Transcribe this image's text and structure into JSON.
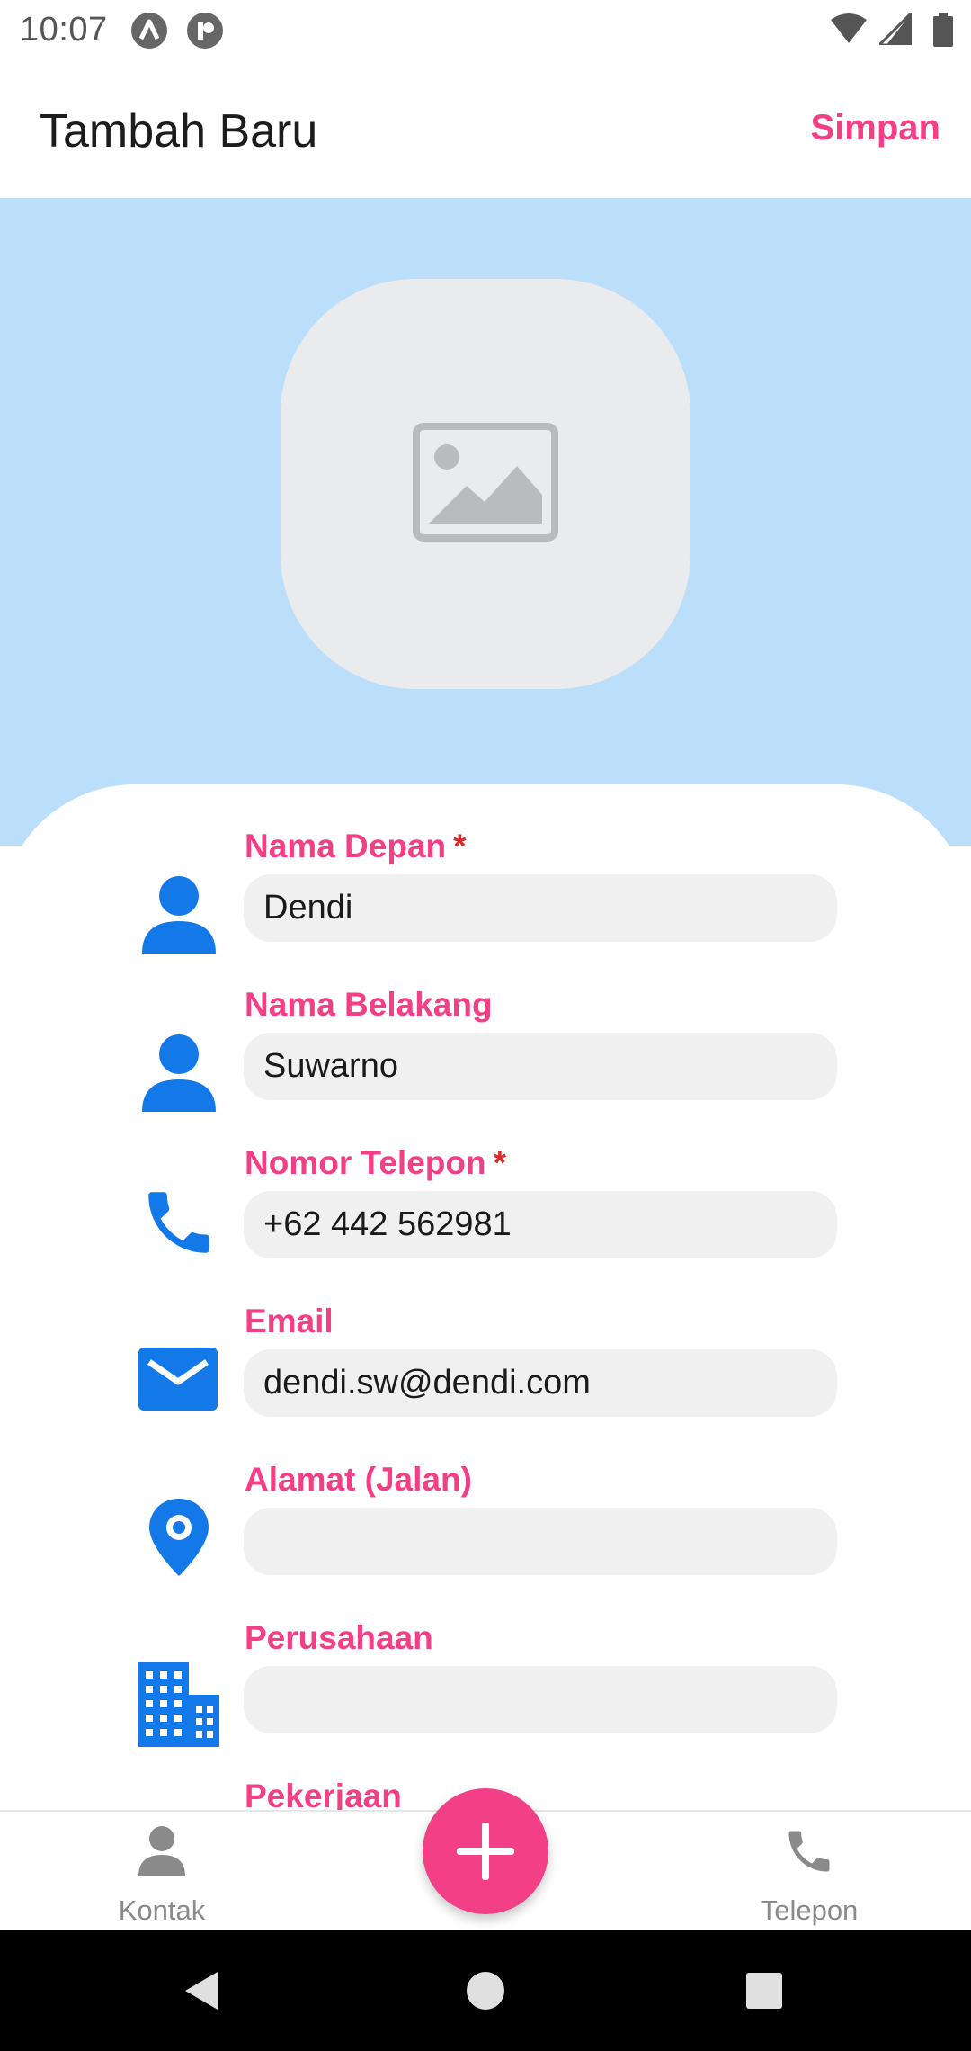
{
  "status_bar": {
    "time": "10:07",
    "left_icons": [
      "app-a-icon",
      "app-p-icon"
    ],
    "right_icons": [
      "wifi-icon",
      "cellular-signal-icon",
      "battery-icon"
    ]
  },
  "app_bar": {
    "title": "Tambah Baru",
    "save_label": "Simpan"
  },
  "photo": {
    "icon": "image-placeholder-icon"
  },
  "fields": [
    {
      "label": "Nama Depan",
      "required_mark": "*",
      "value": "Dendi",
      "icon": "person-icon"
    },
    {
      "label": "Nama Belakang",
      "required_mark": "",
      "value": "Suwarno",
      "icon": "person-icon"
    },
    {
      "label": "Nomor Telepon",
      "required_mark": "*",
      "value": "+62 442 562981",
      "icon": "phone-icon"
    },
    {
      "label": "Email",
      "required_mark": "",
      "value": "dendi.sw@dendi.com",
      "icon": "email-icon"
    },
    {
      "label": "Alamat (Jalan)",
      "required_mark": "",
      "value": "",
      "icon": "location-pin-icon"
    },
    {
      "label": "Perusahaan",
      "required_mark": "",
      "value": "",
      "icon": "building-icon"
    },
    {
      "label": "Pekerjaan",
      "required_mark": "",
      "value": "",
      "icon": ""
    }
  ],
  "bottom_nav": {
    "items": [
      {
        "label": "Kontak",
        "icon": "person-icon"
      },
      {
        "label": "Telepon",
        "icon": "phone-icon"
      }
    ],
    "fab_icon": "plus-icon"
  },
  "system_nav": [
    "back-icon",
    "home-icon",
    "recents-icon"
  ],
  "colors": {
    "accent": "#f23f86",
    "header_bg": "#bbdefa",
    "field_icon": "#1479e8",
    "required": "#d42b2b"
  }
}
